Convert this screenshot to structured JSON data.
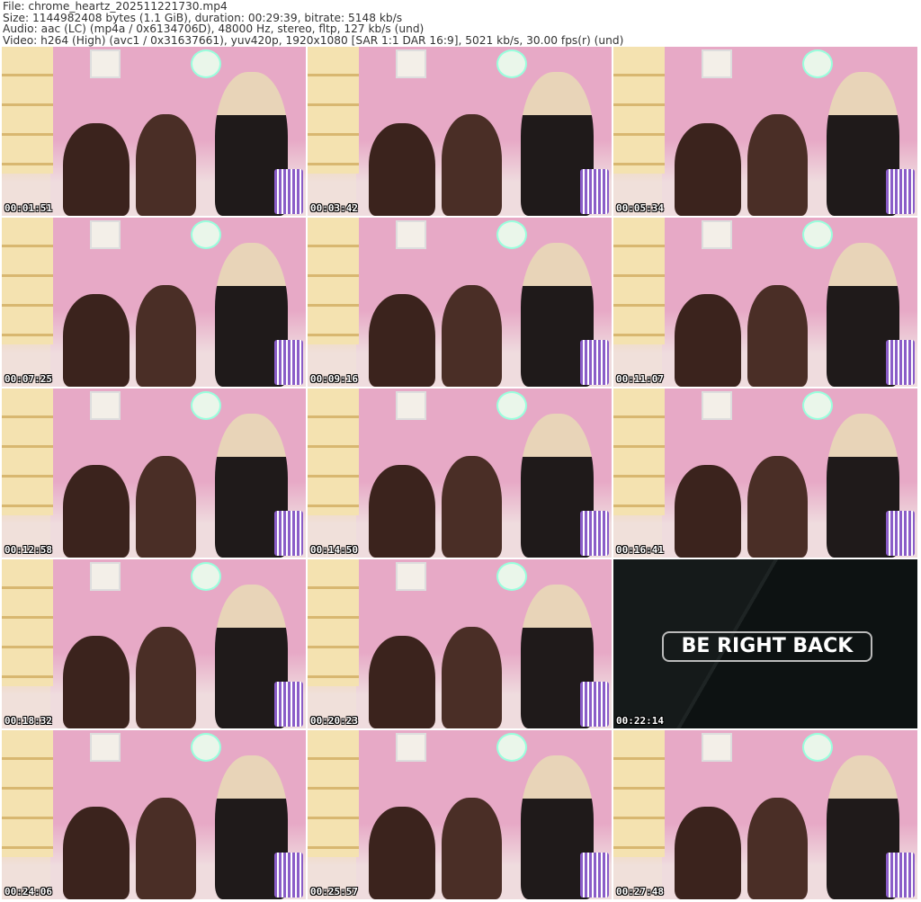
{
  "header": {
    "file": "File: chrome_heartz_202511221730.mp4",
    "size": "Size: 1144982408 bytes (1.1 GiB), duration: 00:29:39, bitrate: 5148 kb/s",
    "audio": "Audio: aac (LC) (mp4a / 0x6134706D), 48000 Hz, stereo, fltp, 127 kb/s (und)",
    "video": "Video: h264 (High) (avc1 / 0x31637661), yuv420p, 1920x1080 [SAR 1:1 DAR 16:9], 5021 kb/s, 30.00 fps(r) (und)"
  },
  "thumbnails": [
    {
      "timestamp": "00:01:51"
    },
    {
      "timestamp": "00:03:42"
    },
    {
      "timestamp": "00:05:34"
    },
    {
      "timestamp": "00:07:25"
    },
    {
      "timestamp": "00:09:16"
    },
    {
      "timestamp": "00:11:07"
    },
    {
      "timestamp": "00:12:58"
    },
    {
      "timestamp": "00:14:50"
    },
    {
      "timestamp": "00:16:41"
    },
    {
      "timestamp": "00:18:32"
    },
    {
      "timestamp": "00:20:23"
    },
    {
      "timestamp": "00:22:14",
      "overlay_text": "BE RIGHT BACK"
    },
    {
      "timestamp": "00:24:06"
    },
    {
      "timestamp": "00:25:57"
    },
    {
      "timestamp": "00:27:48"
    }
  ]
}
